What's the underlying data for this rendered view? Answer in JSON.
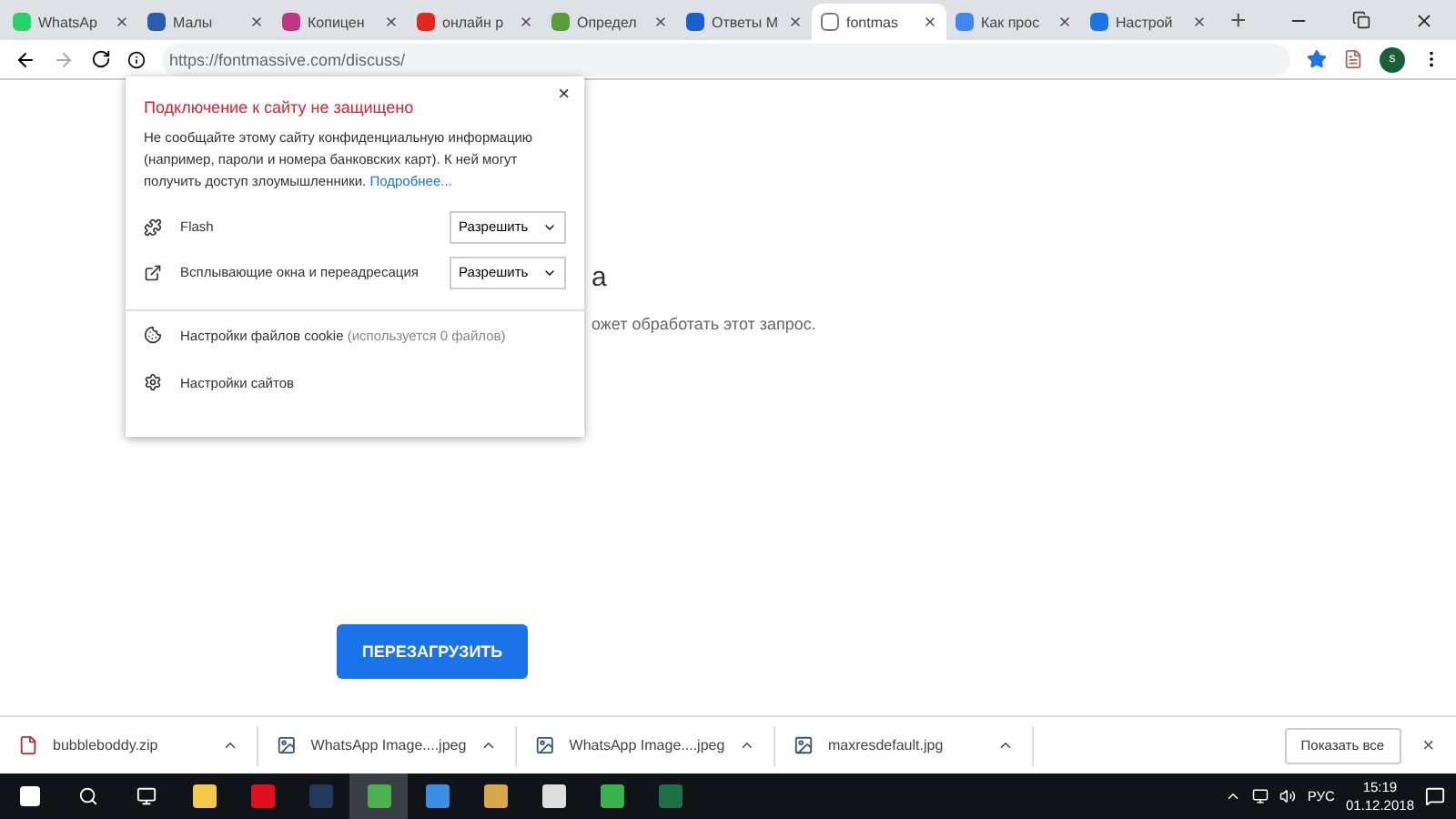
{
  "tabs": [
    {
      "title": "WhatsAp",
      "selected": false,
      "color": "#25d366"
    },
    {
      "title": "Малы",
      "selected": false,
      "color": "#2a5cad"
    },
    {
      "title": "Копицен",
      "selected": false,
      "color": "#c13584"
    },
    {
      "title": "онлайн р",
      "selected": false,
      "color": "#e52620"
    },
    {
      "title": "Определ",
      "selected": false,
      "color": "#5a9e3a"
    },
    {
      "title": "Ответы М",
      "selected": false,
      "color": "#1a5fd0"
    },
    {
      "title": "fontmas",
      "selected": true,
      "color": "#ffffff"
    },
    {
      "title": "Как прос",
      "selected": false,
      "color": "#4285f4"
    },
    {
      "title": "Настрой",
      "selected": false,
      "color": "#1a73e8"
    }
  ],
  "new_tab": "+",
  "address": {
    "url": "https://fontmassive.com/discuss/"
  },
  "profile": {
    "initial": "s"
  },
  "popup": {
    "close": "×",
    "title": "Подключение к сайту не защищено",
    "message": "Не сообщайте этому сайту конфиденциальную информацию (например, пароли и номера банковских карт). К ней могут получить доступ злоумышленники.",
    "link": "Подробнее...",
    "permissions": [
      {
        "label": "Flash",
        "value": "Разрешить"
      },
      {
        "label": "Всплывающие окна и переадресация",
        "value": "Разрешить"
      }
    ],
    "links": [
      {
        "label": "Настройки файлов cookie",
        "note": "(используется 0 файлов)"
      },
      {
        "label": "Настройки сайтов"
      }
    ]
  },
  "page": {
    "heading": "а",
    "message": "ожет обработать этот запрос.",
    "reload": "ПЕРЕЗАГРУЗИТЬ"
  },
  "downloads": [
    {
      "name": "bubbleboddy.zip",
      "kind": "archive"
    },
    {
      "name": "WhatsApp Image....jpeg",
      "kind": "image"
    },
    {
      "name": "WhatsApp Image....jpeg",
      "kind": "image"
    },
    {
      "name": "maxresdefault.jpg",
      "kind": "image"
    }
  ],
  "show_all": "Показать все",
  "close_downloads": "×",
  "taskbar": {
    "apps": [
      {
        "color": "#f3c94a",
        "selected": false
      },
      {
        "color": "#e0101e",
        "selected": false
      },
      {
        "color": "#1f3a5c",
        "selected": false
      },
      {
        "color": "#4caf50",
        "selected": true
      },
      {
        "color": "#3a8ee6",
        "selected": false
      },
      {
        "color": "#d7a84a",
        "selected": false
      },
      {
        "color": "#dddddd",
        "selected": false
      },
      {
        "color": "#35b34a",
        "selected": false
      },
      {
        "color": "#1e7145",
        "selected": false
      }
    ],
    "language": "РУС",
    "time": "15:19",
    "date": "01.12.2018"
  }
}
